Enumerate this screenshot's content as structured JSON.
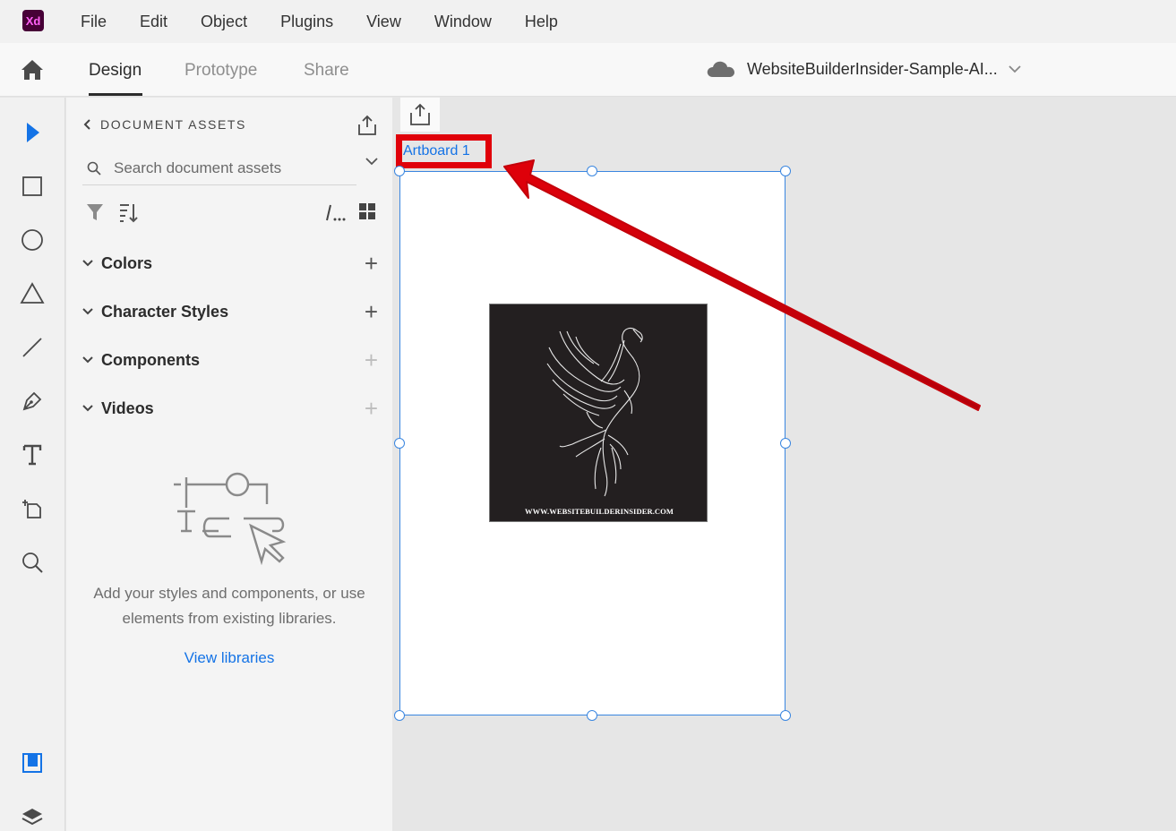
{
  "app": {
    "logo": "Xd"
  },
  "menu": [
    "File",
    "Edit",
    "Object",
    "Plugins",
    "View",
    "Window",
    "Help"
  ],
  "tabs": {
    "design": "Design",
    "prototype": "Prototype",
    "share": "Share"
  },
  "document": {
    "title": "WebsiteBuilderInsider-Sample-AI..."
  },
  "assets_panel": {
    "header": "DOCUMENT ASSETS",
    "search_placeholder": "Search document assets",
    "sections": [
      {
        "label": "Colors",
        "add_enabled": true
      },
      {
        "label": "Character Styles",
        "add_enabled": true
      },
      {
        "label": "Components",
        "add_enabled": false
      },
      {
        "label": "Videos",
        "add_enabled": false
      }
    ],
    "empty_text_line1": "Add your styles and components, or use",
    "empty_text_line2": "elements from existing libraries.",
    "view_libraries": "View libraries"
  },
  "canvas": {
    "artboard_label": "Artboard 1",
    "image_caption": "WWW.WEBSITEBUILDERINSIDER.COM"
  },
  "colors": {
    "accent": "#1473e6",
    "selection": "#3a86e0",
    "annotation": "#e0000a"
  }
}
